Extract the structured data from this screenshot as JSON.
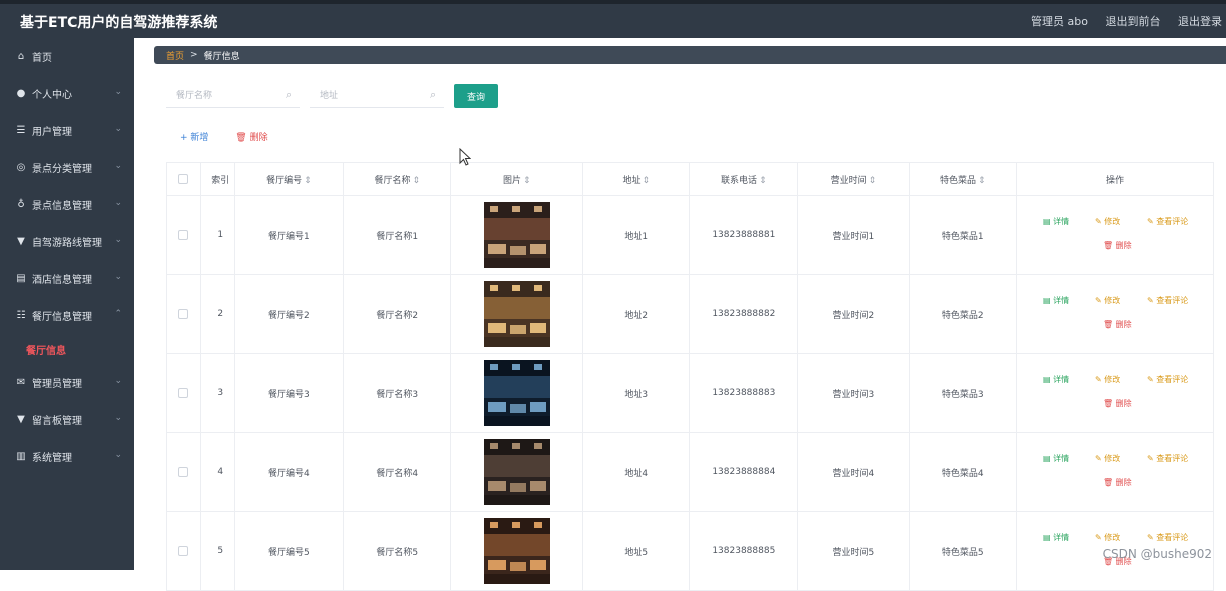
{
  "header": {
    "app_title": "基于ETC用户的自驾游推荐系统",
    "admin_label": "管理员 abo",
    "exit_front": "退出到前台",
    "logout": "退出登录"
  },
  "sidebar": {
    "items": [
      {
        "label": "首页",
        "icon": "home-icon",
        "glyph": "⌂",
        "chevron": ""
      },
      {
        "label": "个人中心",
        "icon": "user-icon",
        "glyph": "●",
        "chevron": "⌄"
      },
      {
        "label": "用户管理",
        "icon": "list-icon",
        "glyph": "☰",
        "chevron": "⌄"
      },
      {
        "label": "景点分类管理",
        "icon": "compass-icon",
        "glyph": "◎",
        "chevron": "⌄"
      },
      {
        "label": "景点信息管理",
        "icon": "mic-icon",
        "glyph": "♁",
        "chevron": "⌄"
      },
      {
        "label": "自驾游路线管理",
        "icon": "sign-icon",
        "glyph": "▼",
        "chevron": "⌄"
      },
      {
        "label": "酒店信息管理",
        "icon": "card-icon",
        "glyph": "▤",
        "chevron": "⌄"
      },
      {
        "label": "餐厅信息管理",
        "icon": "sliders-icon",
        "glyph": "☷",
        "chevron": "⌃"
      },
      {
        "label": "管理员管理",
        "icon": "mail-icon",
        "glyph": "✉",
        "chevron": "⌄"
      },
      {
        "label": "留言板管理",
        "icon": "message-icon",
        "glyph": "▼",
        "chevron": "⌄"
      },
      {
        "label": "系统管理",
        "icon": "trash-icon",
        "glyph": "▥",
        "chevron": "⌄"
      }
    ],
    "active_sub": "餐厅信息"
  },
  "breadcrumb": {
    "home": "首页",
    "separator": ">",
    "current": "餐厅信息"
  },
  "search": {
    "name_placeholder": "餐厅名称",
    "address_placeholder": "地址",
    "query_button": "查询"
  },
  "actions": {
    "add": "+ 新增",
    "delete": "删除"
  },
  "table": {
    "columns": [
      "索引",
      "餐厅编号",
      "餐厅名称",
      "图片",
      "地址",
      "联系电话",
      "营业时间",
      "特色菜品",
      "操作"
    ],
    "sort_glyph": "⇕",
    "op_labels": {
      "detail": "详情",
      "edit": "修改",
      "review": "查看评论",
      "delete": "删除"
    },
    "rows": [
      {
        "index": "1",
        "code": "餐厅编号1",
        "name": "餐厅名称1",
        "address": "地址1",
        "phone": "13823888881",
        "hours": "营业时间1",
        "dish": "特色菜品1"
      },
      {
        "index": "2",
        "code": "餐厅编号2",
        "name": "餐厅名称2",
        "address": "地址2",
        "phone": "13823888882",
        "hours": "营业时间2",
        "dish": "特色菜品2"
      },
      {
        "index": "3",
        "code": "餐厅编号3",
        "name": "餐厅名称3",
        "address": "地址3",
        "phone": "13823888883",
        "hours": "营业时间3",
        "dish": "特色菜品3"
      },
      {
        "index": "4",
        "code": "餐厅编号4",
        "name": "餐厅名称4",
        "address": "地址4",
        "phone": "13823888884",
        "hours": "营业时间4",
        "dish": "特色菜品4"
      },
      {
        "index": "5",
        "code": "餐厅编号5",
        "name": "餐厅名称5",
        "address": "地址5",
        "phone": "13823888885",
        "hours": "营业时间5",
        "dish": "特色菜品5"
      }
    ]
  },
  "watermark": "CSDN @bushe902",
  "colors": {
    "sidebar_bg": "#303a46",
    "active_sub": "#f0565c",
    "query_btn": "#1d9f8a",
    "detail": "#27a35c",
    "edit": "#d99a1a",
    "delete": "#e04c4c",
    "add": "#3e82d6"
  }
}
